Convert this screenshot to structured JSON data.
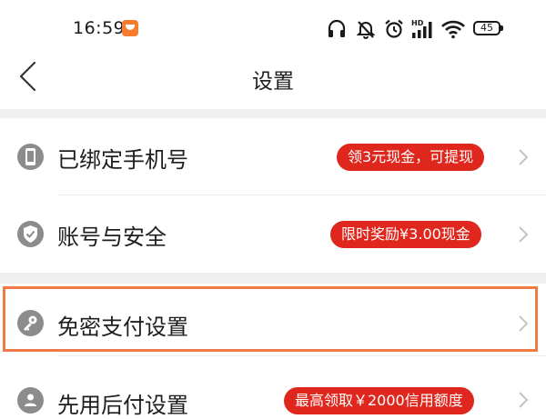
{
  "status_bar": {
    "time": "16:59",
    "battery": "45",
    "icons": [
      "headphones-icon",
      "mute-bell-icon",
      "alarm-icon",
      "hd-signal-icon",
      "wifi-icon",
      "battery-icon"
    ]
  },
  "nav": {
    "title": "设置",
    "back_icon": "chevron-left-icon"
  },
  "rows": [
    {
      "label": "已绑定手机号",
      "promo": "领3元现金，可提现",
      "icon": "phone-icon"
    },
    {
      "label": "账号与安全",
      "promo": "限时奖励¥3.00现金",
      "icon": "shield-check-icon"
    },
    {
      "label": "免密支付设置",
      "promo": "",
      "icon": "key-icon"
    },
    {
      "label": "先用后付设置",
      "promo": "最高领取￥2000信用额度",
      "icon": "gear-user-icon"
    }
  ],
  "colors": {
    "promo_red": "#e0271d",
    "icon_gray": "#8c8c8c",
    "highlight_orange": "#f07a45",
    "section_gap": "#efefef"
  }
}
